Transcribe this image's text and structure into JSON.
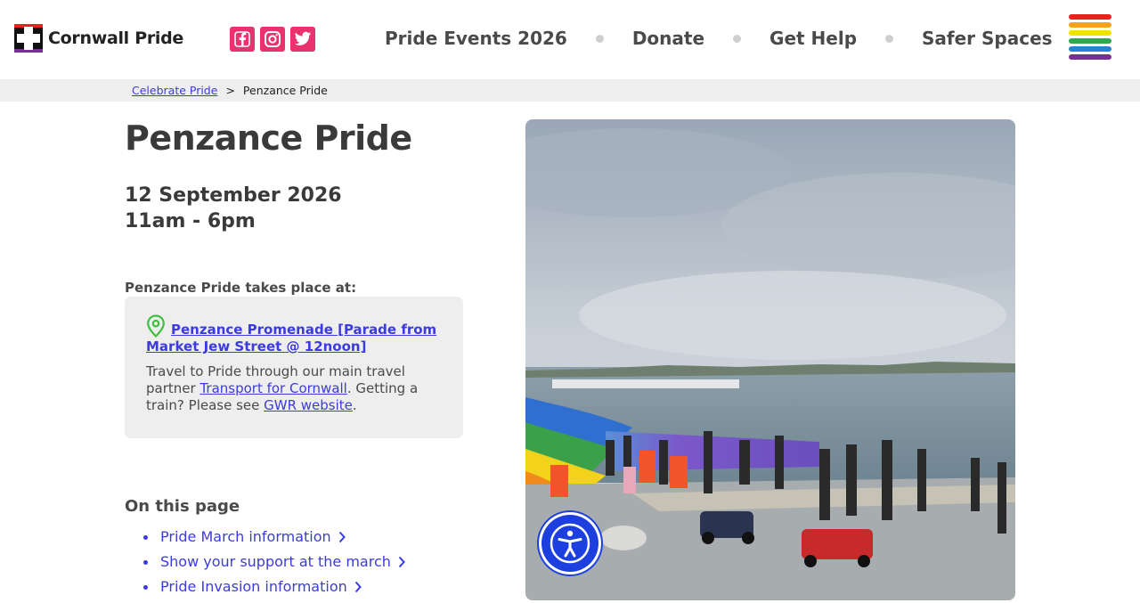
{
  "brand": {
    "name": "Cornwall Pride",
    "colors": {
      "pink": "#e8336e",
      "link": "#3b3be0",
      "accessibility": "#1d3fe0"
    },
    "rainbow": [
      "#e52420",
      "#f6a21c",
      "#f2e200",
      "#2fa84f",
      "#2a80d6",
      "#7a2f96"
    ]
  },
  "socials": [
    {
      "name": "facebook-icon"
    },
    {
      "name": "instagram-icon"
    },
    {
      "name": "twitter-icon"
    }
  ],
  "nav": {
    "items": [
      "Pride Events 2026",
      "Donate",
      "Get Help",
      "Safer Spaces"
    ]
  },
  "breadcrumb": {
    "parent": "Celebrate Pride",
    "separator": ">",
    "current": "Penzance Pride"
  },
  "event": {
    "title": "Penzance Pride",
    "date": "12 September 2026",
    "time": "11am - 6pm",
    "place_label": "Penzance Pride takes place at:",
    "venue": "Penzance Promenade [Parade from Market Jew Street @ 12noon]",
    "travel_pre": "Travel to Pride through our main travel partner ",
    "travel_link": "Transport for Cornwall",
    "travel_mid": ". Getting a train? Please see ",
    "gwr_link": "GWR website",
    "travel_end": "."
  },
  "on_this_page": {
    "heading": "On this page",
    "links": [
      "Pride March information",
      "Show your support at the march",
      "Pride Invasion information"
    ]
  },
  "accessibility_button": {
    "icon": "accessibility-person-icon"
  }
}
